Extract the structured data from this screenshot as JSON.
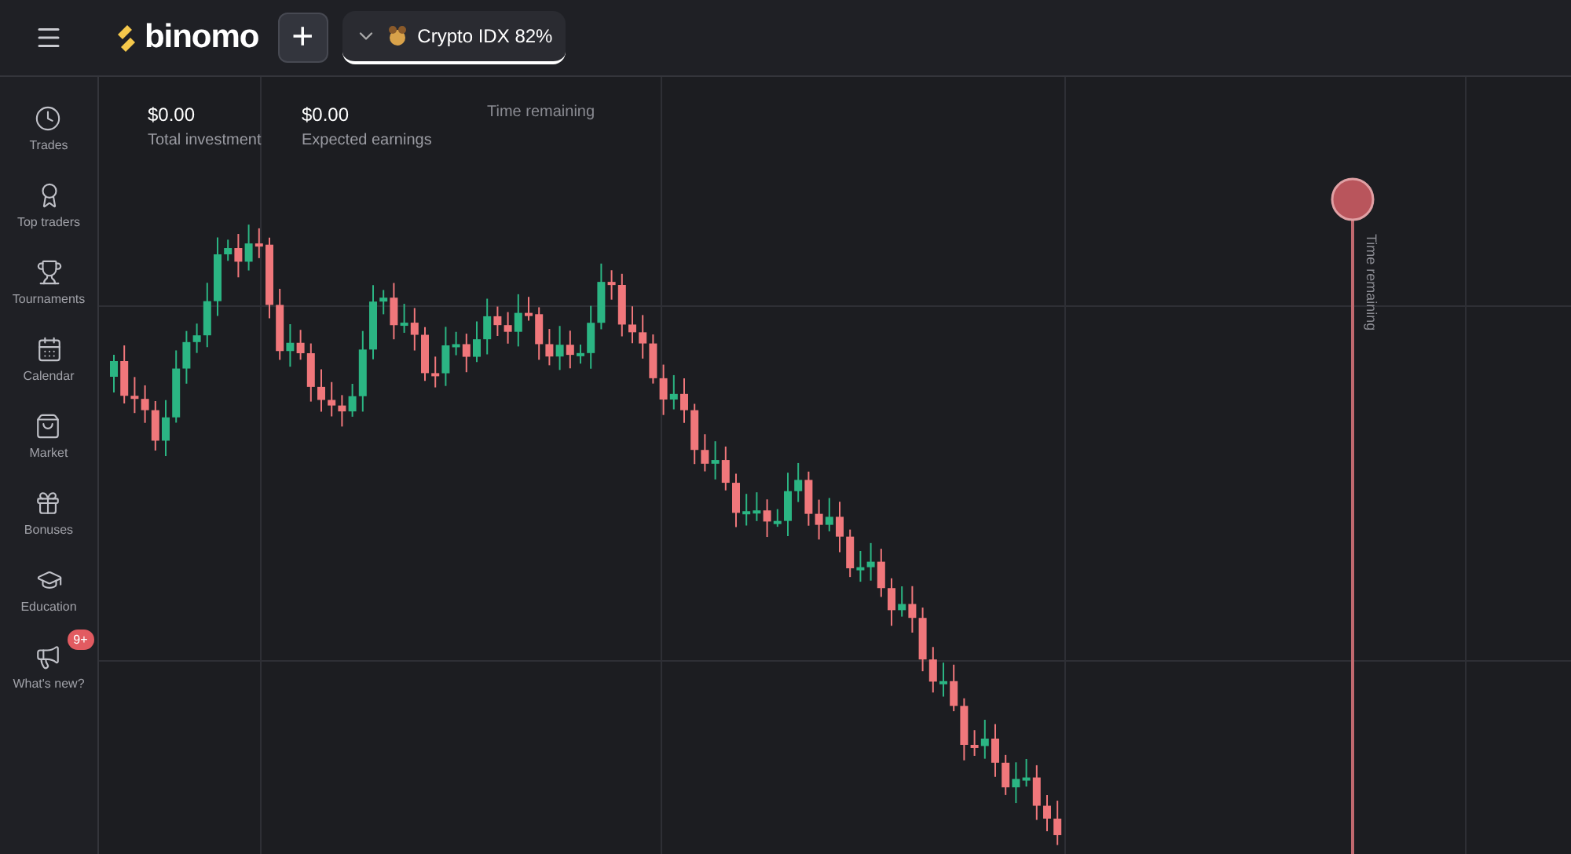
{
  "top_bar": {
    "logo": "binomo",
    "add_button": "+",
    "asset": "Crypto IDX 82%"
  },
  "sidebar": {
    "items": [
      {
        "kind": "clock",
        "label": "Trades"
      },
      {
        "kind": "award",
        "label": "Top traders"
      },
      {
        "kind": "trophy",
        "label": "Tournaments"
      },
      {
        "kind": "calendar",
        "label": "Calendar"
      },
      {
        "kind": "bag",
        "label": "Market"
      },
      {
        "kind": "gift",
        "label": "Bonuses"
      },
      {
        "kind": "cap",
        "label": "Education"
      },
      {
        "kind": "megaphone",
        "label": "What's new?",
        "badge": "9+"
      }
    ]
  },
  "stats": [
    {
      "value": "$0.00",
      "label": "Total investment"
    },
    {
      "value": "$0.00",
      "label": "Expected earnings"
    }
  ],
  "time_remaining_label": "Time remaining",
  "chart_marker": {
    "label": "Time remaining"
  }
}
